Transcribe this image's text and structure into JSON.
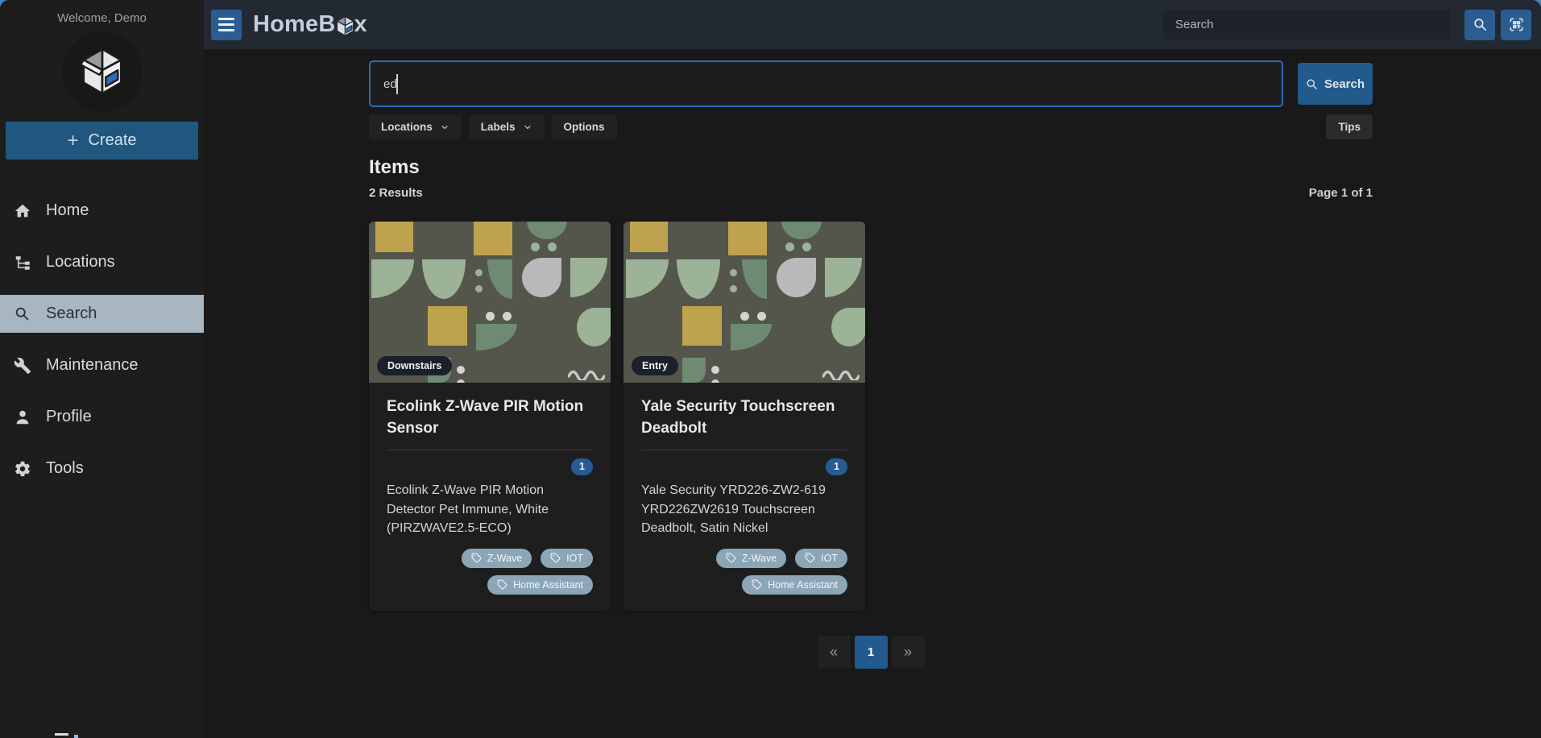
{
  "sidebar": {
    "welcome": "Welcome, Demo",
    "create_label": "Create",
    "items": [
      {
        "label": "Home"
      },
      {
        "label": "Locations"
      },
      {
        "label": "Search"
      },
      {
        "label": "Maintenance"
      },
      {
        "label": "Profile"
      },
      {
        "label": "Tools"
      }
    ]
  },
  "topbar": {
    "brand_prefix": "HomeB",
    "brand_suffix": "x",
    "search_placeholder": "Search"
  },
  "search": {
    "query": "ed",
    "filters": [
      {
        "label": "Locations"
      },
      {
        "label": "Labels"
      },
      {
        "label": "Options"
      }
    ],
    "tips_label": "Tips",
    "button_label": "Search"
  },
  "results": {
    "heading": "Items",
    "count_text": "2 Results",
    "page_text": "Page 1 of 1"
  },
  "items": [
    {
      "location": "Downstairs",
      "title": "Ecolink Z-Wave PIR Motion Sensor",
      "quantity": "1",
      "description": "Ecolink Z-Wave PIR Motion Detector Pet Immune, White (PIRZWAVE2.5-ECO)",
      "labels": [
        "Z-Wave",
        "IOT",
        "Home Assistant"
      ]
    },
    {
      "location": "Entry",
      "title": "Yale Security Touchscreen Deadbolt",
      "quantity": "1",
      "description": "Yale Security YRD226-ZW2-619 YRD226ZW2619 Touchscreen Deadbolt, Satin Nickel",
      "labels": [
        "Z-Wave",
        "IOT",
        "Home Assistant"
      ]
    }
  ],
  "pagination": {
    "prev": "«",
    "current": "1",
    "next": "»"
  },
  "colors": {
    "accent_blue": "#235a8c",
    "focus_blue": "#2e6cb2",
    "topbar_bg": "#232933",
    "active_nav_bg": "#a7b6c0",
    "tag_bg": "#8ba6b6",
    "count_badge_bg": "#265c93",
    "card_art_bg": "#54564c"
  }
}
